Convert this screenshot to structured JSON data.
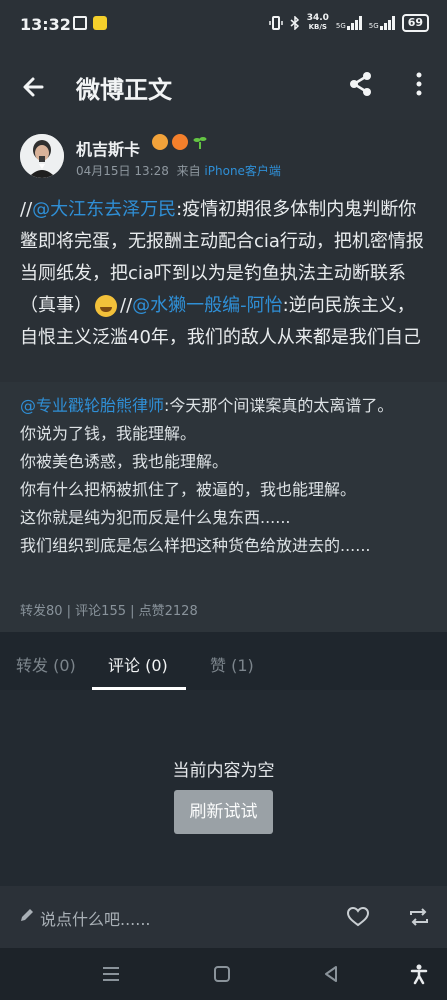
{
  "status_bar": {
    "time": "13:32",
    "net_speed_value": "34.0",
    "net_speed_unit": "KB/S",
    "network_label_1": "5G",
    "network_label_2": "5G",
    "battery": "69"
  },
  "header": {
    "title": "微博正文",
    "icons": [
      "back-arrow-icon",
      "share-icon",
      "more-vertical-icon"
    ]
  },
  "post": {
    "author": "机吉斯卡",
    "time": "04月15日 13:28",
    "source_prefix": "来自",
    "source_client": "iPhone客户端",
    "segments": [
      {
        "type": "text",
        "value": "//"
      },
      {
        "type": "mention",
        "value": "@大江东去泽万民"
      },
      {
        "type": "text",
        "value": ":疫情初期很多体制内鬼判断你鳖即将完蛋，无报酬主动配合cia行动，把机密情报当厕纸发，把cia吓到以为是钓鱼执法主动断联系（真事）"
      },
      {
        "type": "text",
        "value": "//"
      },
      {
        "type": "mention",
        "value": "@水獭一般编-阿怡"
      },
      {
        "type": "text",
        "value": ":逆向民族主义，自恨主义泛滥40年，我们的敌人从来都是我们自己"
      }
    ]
  },
  "repost": {
    "mention": "@专业戳轮胎熊律师",
    "lines": [
      ":今天那个间谍案真的太离谱了。",
      "你说为了钱，我能理解。",
      "你被美色诱惑，我也能理解。",
      "你有什么把柄被抓住了，被逼的，我也能理解。",
      "这你就是纯为犯而反是什么鬼东西......",
      "我们组织到底是怎么样把这种货色给放进去的......"
    ],
    "stats": "转发80 | 评论155 | 点赞2128"
  },
  "tabs": [
    {
      "label": "转发 (0)",
      "active": false
    },
    {
      "label": "评论 (0)",
      "active": true
    },
    {
      "label": "赞 (1)",
      "active": false
    }
  ],
  "empty_state": {
    "message": "当前内容为空",
    "refresh_label": "刷新试试"
  },
  "comment_bar": {
    "placeholder": "说点什么吧......",
    "icons": [
      "pencil-icon",
      "heart-icon",
      "repost-icon"
    ]
  },
  "nav_bar": {
    "icons": [
      "menu-icon",
      "home-square-icon",
      "back-triangle-icon",
      "accessibility-icon"
    ]
  },
  "colors": {
    "accent": "#2f8fd6",
    "background": "#232a31"
  }
}
